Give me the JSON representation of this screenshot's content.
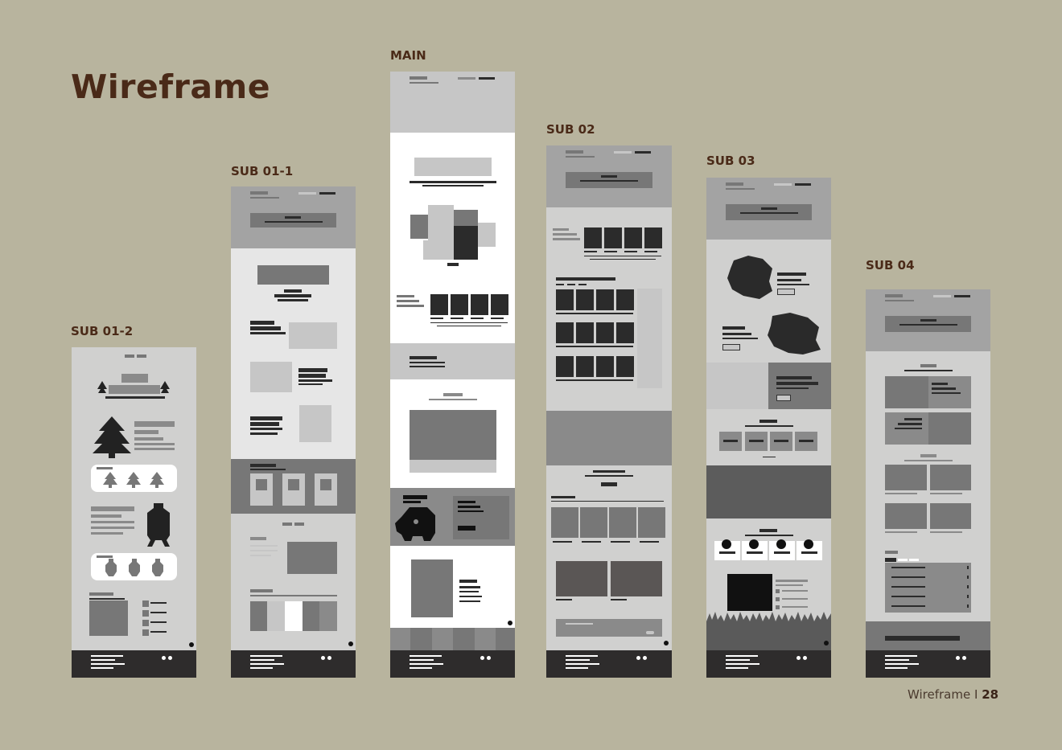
{
  "title": "Wireframe",
  "pages": [
    {
      "label": "SUB 01-2"
    },
    {
      "label": "SUB 01-1"
    },
    {
      "label": "MAIN"
    },
    {
      "label": "SUB 02"
    },
    {
      "label": "SUB 03"
    },
    {
      "label": "SUB 04"
    }
  ],
  "footer": {
    "text": "Wireframe",
    "separator": "I",
    "page": "28"
  }
}
